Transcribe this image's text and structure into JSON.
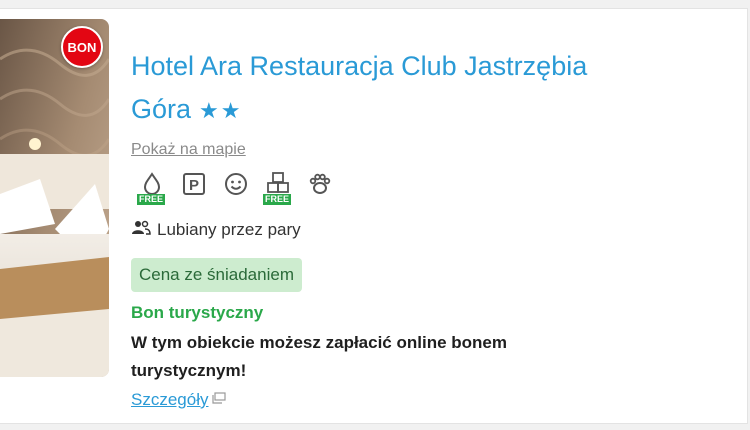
{
  "hotel": {
    "name": "Hotel Ara Restauracja Club Jastrzębia Góra",
    "stars": "★★",
    "map_link": "Pokaż na mapie",
    "badge": "BON"
  },
  "amenities": [
    {
      "icon": "water-drop-icon",
      "free_label": "FREE"
    },
    {
      "icon": "parking-icon",
      "text": "P"
    },
    {
      "icon": "smiley-child-icon"
    },
    {
      "icon": "baby-blocks-icon",
      "free_label": "FREE"
    },
    {
      "icon": "paw-pet-icon"
    }
  ],
  "tags": {
    "pairs": "Lubiany przez pary",
    "breakfast": "Cena ze śniadaniem"
  },
  "voucher": {
    "title": "Bon turystyczny",
    "description": "W tym obiekcie możesz zapłacić online bonem turystycznym!",
    "details_link": "Szczegóły"
  },
  "colors": {
    "accent": "#2a9ad6",
    "green": "#2aa84a",
    "badge_red": "#e30613"
  }
}
